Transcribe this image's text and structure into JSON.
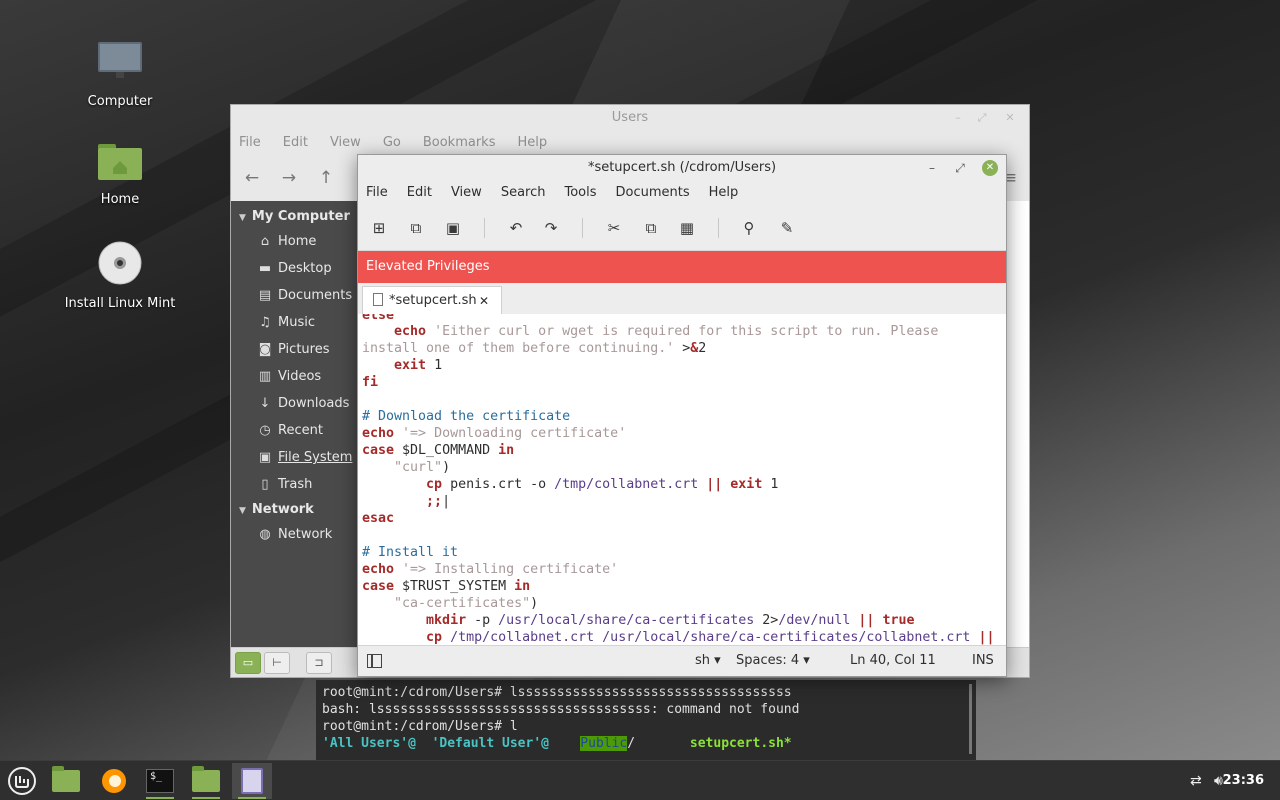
{
  "desktop": {
    "icons": [
      {
        "label": "Computer"
      },
      {
        "label": "Home"
      },
      {
        "label": "Install Linux Mint"
      }
    ]
  },
  "file_manager": {
    "title": "Users",
    "menu": [
      "File",
      "Edit",
      "View",
      "Go",
      "Bookmarks",
      "Help"
    ],
    "sidebar": {
      "section1": "My Computer",
      "items": [
        {
          "label": "Home",
          "icon": "home-icon"
        },
        {
          "label": "Desktop",
          "icon": "desktop-folder-icon"
        },
        {
          "label": "Documents",
          "icon": "document-icon"
        },
        {
          "label": "Music",
          "icon": "music-icon"
        },
        {
          "label": "Pictures",
          "icon": "camera-icon"
        },
        {
          "label": "Videos",
          "icon": "film-icon"
        },
        {
          "label": "Downloads",
          "icon": "download-icon"
        },
        {
          "label": "Recent",
          "icon": "clock-icon"
        },
        {
          "label": "File System",
          "icon": "drive-icon"
        },
        {
          "label": "Trash",
          "icon": "trash-icon"
        }
      ],
      "section2": "Network",
      "network_items": [
        {
          "label": "Network",
          "icon": "globe-icon"
        }
      ]
    }
  },
  "editor": {
    "title": "*setupcert.sh (/cdrom/Users)",
    "menu": [
      "File",
      "Edit",
      "View",
      "Search",
      "Tools",
      "Documents",
      "Help"
    ],
    "banner": "Elevated Privileges",
    "tab_label": "*setupcert.sh",
    "status": {
      "language": "sh",
      "spaces": "Spaces: 4",
      "position": "Ln 40, Col 11",
      "mode": "INS"
    }
  },
  "terminal": {
    "lines": [
      "root@mint:/cdrom/Users# lsssssssssssssssssssssssssssssssssss",
      "bash: lsssssssssssssssssssssssssssssssssss: command not found",
      "root@mint:/cdrom/Users# l"
    ],
    "listing": {
      "all_users": "'All Users'@",
      "default_user": "'Default User'@",
      "public": "Public",
      "setupcert": "setupcert.sh*"
    }
  },
  "taskbar": {
    "clock": "23:36"
  },
  "colors": {
    "accent": "#8bb156",
    "banner": "#ef5350",
    "keyword": "#a52a2a",
    "string": "#a89898",
    "comment": "#2a6e9e"
  }
}
